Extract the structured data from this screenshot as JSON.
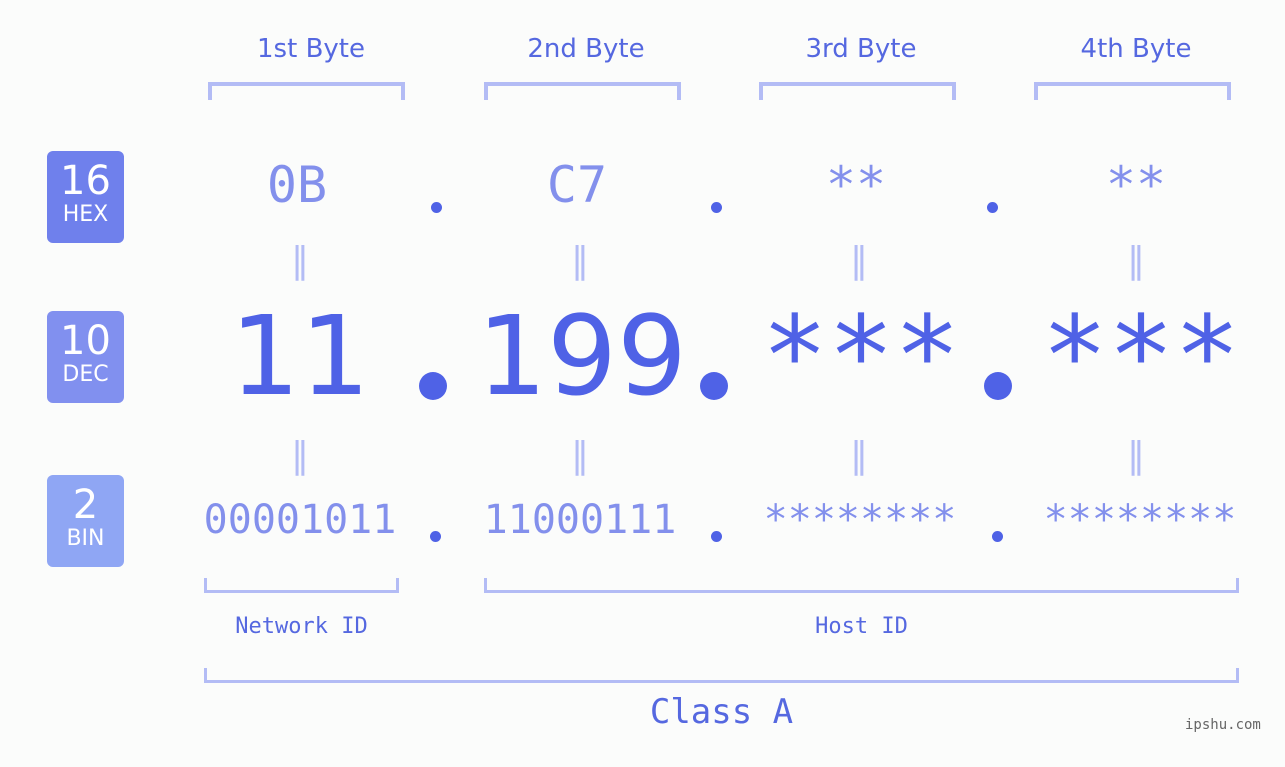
{
  "byte_headers": [
    "1st Byte",
    "2nd Byte",
    "3rd Byte",
    "4th Byte"
  ],
  "badges": [
    {
      "num": "16",
      "label": "HEX",
      "color": "#6f80ec"
    },
    {
      "num": "10",
      "label": "DEC",
      "color": "#8190ef"
    },
    {
      "num": "2",
      "label": "BIN",
      "color": "#8fa6f4"
    }
  ],
  "hex": [
    "0B",
    "C7",
    "**",
    "**"
  ],
  "dec": [
    "11",
    "199",
    "***",
    "***"
  ],
  "bin": [
    "00001011",
    "11000111",
    "********",
    "********"
  ],
  "equals_symbol": "=",
  "network_id_label": "Network ID",
  "host_id_label": "Host ID",
  "class_label": "Class A",
  "watermark": "ipshu.com"
}
